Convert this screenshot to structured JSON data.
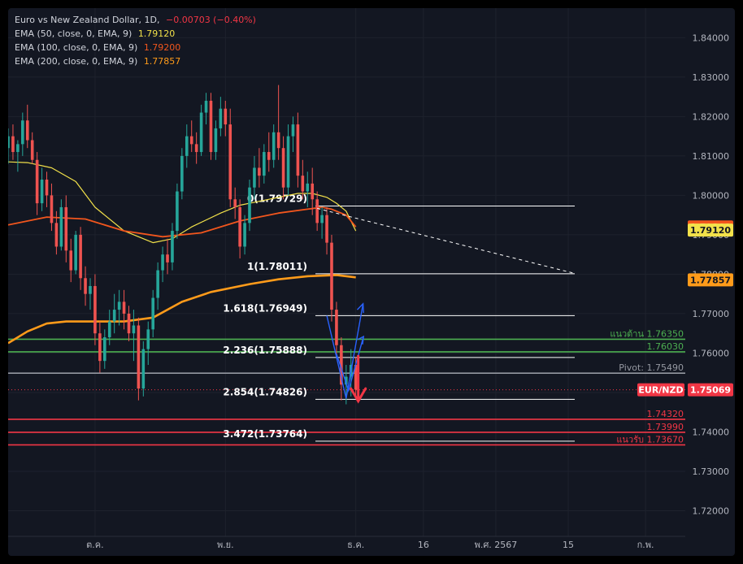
{
  "legend": {
    "symbol": "Euro vs New Zealand Dollar, 1D,",
    "change": "−0.00703 (−0.40%)",
    "ema50": {
      "label": "EMA (50, close, 0, EMA, 9)",
      "value": "1.79120",
      "color": "#f2e14a"
    },
    "ema100": {
      "label": "EMA (100, close, 0, EMA, 9)",
      "value": "1.79200",
      "color": "#f2561d"
    },
    "ema200": {
      "label": "EMA (200, close, 0, EMA, 9)",
      "value": "1.77857",
      "color": "#ff9b1a"
    }
  },
  "colors": {
    "up": "#26a69a",
    "down": "#ef5350",
    "background": "#131722",
    "text": "#b2b5be",
    "grid": "#1e222d"
  },
  "chart_data": {
    "type": "candlestick",
    "y_axis_ticks": [
      "1.84000",
      "1.83000",
      "1.82000",
      "1.81000",
      "1.80000",
      "1.79000",
      "1.78000",
      "1.77000",
      "1.76000",
      "1.75000",
      "1.74000",
      "1.73000",
      "1.72000"
    ],
    "ylim": [
      1.7135,
      1.8475
    ],
    "x_axis_labels": [
      {
        "label": "ต.ค.",
        "idx": 18
      },
      {
        "label": "พ.ย.",
        "idx": 45
      },
      {
        "label": "ธ.ค.",
        "idx": 72
      },
      {
        "label": "16",
        "idx": 86
      },
      {
        "label": "พ.ศ. 2567",
        "idx": 101
      },
      {
        "label": "15",
        "idx": 116
      },
      {
        "label": "ก.พ.",
        "idx": 132
      }
    ],
    "candles": [
      [
        1.812,
        1.817,
        1.808,
        1.815
      ],
      [
        1.815,
        1.818,
        1.809,
        1.811
      ],
      [
        1.811,
        1.814,
        1.806,
        1.813
      ],
      [
        1.813,
        1.821,
        1.81,
        1.819
      ],
      [
        1.819,
        1.823,
        1.812,
        1.814
      ],
      [
        1.814,
        1.816,
        1.808,
        1.809
      ],
      [
        1.809,
        1.811,
        1.795,
        1.798
      ],
      [
        1.798,
        1.807,
        1.796,
        1.804
      ],
      [
        1.804,
        1.806,
        1.797,
        1.8
      ],
      [
        1.8,
        1.803,
        1.791,
        1.793
      ],
      [
        1.793,
        1.796,
        1.785,
        1.787
      ],
      [
        1.787,
        1.799,
        1.786,
        1.797
      ],
      [
        1.797,
        1.8,
        1.783,
        1.786
      ],
      [
        1.786,
        1.789,
        1.778,
        1.781
      ],
      [
        1.781,
        1.791,
        1.78,
        1.79
      ],
      [
        1.79,
        1.792,
        1.776,
        1.779
      ],
      [
        1.779,
        1.782,
        1.772,
        1.775
      ],
      [
        1.775,
        1.779,
        1.771,
        1.777
      ],
      [
        1.777,
        1.78,
        1.762,
        1.765
      ],
      [
        1.765,
        1.768,
        1.755,
        1.758
      ],
      [
        1.758,
        1.766,
        1.756,
        1.764
      ],
      [
        1.764,
        1.771,
        1.762,
        1.768
      ],
      [
        1.768,
        1.775,
        1.765,
        1.771
      ],
      [
        1.771,
        1.776,
        1.767,
        1.773
      ],
      [
        1.773,
        1.776,
        1.766,
        1.77
      ],
      [
        1.77,
        1.772,
        1.763,
        1.765
      ],
      [
        1.765,
        1.771,
        1.758,
        1.767
      ],
      [
        1.767,
        1.769,
        1.748,
        1.751
      ],
      [
        1.751,
        1.763,
        1.749,
        1.761
      ],
      [
        1.761,
        1.768,
        1.757,
        1.766
      ],
      [
        1.766,
        1.776,
        1.764,
        1.774
      ],
      [
        1.774,
        1.783,
        1.771,
        1.781
      ],
      [
        1.781,
        1.787,
        1.778,
        1.785
      ],
      [
        1.785,
        1.789,
        1.78,
        1.783
      ],
      [
        1.783,
        1.793,
        1.781,
        1.791
      ],
      [
        1.791,
        1.803,
        1.789,
        1.801
      ],
      [
        1.801,
        1.812,
        1.799,
        1.81
      ],
      [
        1.81,
        1.818,
        1.807,
        1.815
      ],
      [
        1.815,
        1.819,
        1.811,
        1.813
      ],
      [
        1.813,
        1.816,
        1.808,
        1.811
      ],
      [
        1.811,
        1.823,
        1.81,
        1.821
      ],
      [
        1.821,
        1.826,
        1.818,
        1.824
      ],
      [
        1.824,
        1.826,
        1.809,
        1.811
      ],
      [
        1.811,
        1.819,
        1.809,
        1.817
      ],
      [
        1.817,
        1.825,
        1.815,
        1.822
      ],
      [
        1.822,
        1.824,
        1.815,
        1.818
      ],
      [
        1.818,
        1.822,
        1.797,
        1.799
      ],
      [
        1.799,
        1.802,
        1.794,
        1.797
      ],
      [
        1.797,
        1.799,
        1.784,
        1.787
      ],
      [
        1.787,
        1.795,
        1.785,
        1.793
      ],
      [
        1.793,
        1.804,
        1.791,
        1.802
      ],
      [
        1.802,
        1.81,
        1.799,
        1.807
      ],
      [
        1.807,
        1.812,
        1.802,
        1.805
      ],
      [
        1.805,
        1.813,
        1.803,
        1.811
      ],
      [
        1.811,
        1.816,
        1.806,
        1.809
      ],
      [
        1.809,
        1.818,
        1.807,
        1.816
      ],
      [
        1.816,
        1.828,
        1.809,
        1.812
      ],
      [
        1.812,
        1.815,
        1.799,
        1.802
      ],
      [
        1.802,
        1.818,
        1.8,
        1.815
      ],
      [
        1.815,
        1.82,
        1.811,
        1.818
      ],
      [
        1.818,
        1.821,
        1.802,
        1.805
      ],
      [
        1.805,
        1.809,
        1.799,
        1.801
      ],
      [
        1.801,
        1.806,
        1.797,
        1.803
      ],
      [
        1.803,
        1.807,
        1.795,
        1.799
      ],
      [
        1.799,
        1.801,
        1.791,
        1.793
      ],
      [
        1.793,
        1.797,
        1.789,
        1.795
      ],
      [
        1.795,
        1.797,
        1.785,
        1.788
      ],
      [
        1.788,
        1.79,
        1.768,
        1.771
      ],
      [
        1.771,
        1.773,
        1.759,
        1.762
      ],
      [
        1.762,
        1.764,
        1.748,
        1.752
      ],
      [
        1.752,
        1.757,
        1.747,
        1.754
      ],
      [
        1.754,
        1.761,
        1.749,
        1.757
      ],
      [
        1.757,
        1.759,
        1.749,
        1.7507
      ]
    ],
    "ema_series": [
      {
        "name": "EMA 50",
        "color": "#f2e14a",
        "points": [
          [
            0,
            1.8085
          ],
          [
            4,
            1.8083
          ],
          [
            9,
            1.807
          ],
          [
            14,
            1.8035
          ],
          [
            18,
            1.797
          ],
          [
            24,
            1.791
          ],
          [
            30,
            1.788
          ],
          [
            34,
            1.789
          ],
          [
            38,
            1.792
          ],
          [
            44,
            1.7955
          ],
          [
            48,
            1.7975
          ],
          [
            52,
            1.7985
          ],
          [
            56,
            1.7995
          ],
          [
            60,
            1.8005
          ],
          [
            63,
            1.8005
          ],
          [
            66,
            1.7995
          ],
          [
            68,
            1.798
          ],
          [
            70,
            1.796
          ],
          [
            72,
            1.791
          ]
        ]
      },
      {
        "name": "EMA 100",
        "color": "#f2561d",
        "points": [
          [
            0,
            1.7925
          ],
          [
            8,
            1.7945
          ],
          [
            16,
            1.794
          ],
          [
            24,
            1.791
          ],
          [
            32,
            1.7895
          ],
          [
            40,
            1.7905
          ],
          [
            48,
            1.7935
          ],
          [
            56,
            1.7955
          ],
          [
            62,
            1.7965
          ],
          [
            65,
            1.797
          ],
          [
            67,
            1.7965
          ],
          [
            70,
            1.795
          ],
          [
            72,
            1.792
          ]
        ]
      },
      {
        "name": "EMA 200",
        "color": "#ff9b1a",
        "points": [
          [
            0,
            1.7625
          ],
          [
            4,
            1.7655
          ],
          [
            8,
            1.7675
          ],
          [
            12,
            1.768
          ],
          [
            18,
            1.768
          ],
          [
            24,
            1.768
          ],
          [
            30,
            1.769
          ],
          [
            36,
            1.773
          ],
          [
            42,
            1.7755
          ],
          [
            50,
            1.7775
          ],
          [
            56,
            1.7787
          ],
          [
            62,
            1.7795
          ],
          [
            68,
            1.7798
          ],
          [
            72,
            1.7792
          ]
        ]
      }
    ],
    "fibonacci": [
      {
        "label": "0(1.79729)",
        "price": 1.79729
      },
      {
        "label": "1(1.78011)",
        "price": 1.78011
      },
      {
        "label": "1.618(1.76949)",
        "price": 1.76949
      },
      {
        "label": "2.236(1.75888)",
        "price": 1.75888
      },
      {
        "label": "2.854(1.74826)",
        "price": 1.74826
      },
      {
        "label": "3.472(1.73764)",
        "price": 1.73764
      }
    ],
    "levels": [
      {
        "label": "แนวต้าน 1.76350",
        "price": 1.7635,
        "color": "#4caf50"
      },
      {
        "label": "1.76030",
        "price": 1.7603,
        "color": "#4caf50"
      },
      {
        "label": "Pivot: 1.75490",
        "price": 1.7549,
        "color": "#9598a1"
      },
      {
        "label": "1.74320",
        "price": 1.7432,
        "color": "#f23645"
      },
      {
        "label": "1.73990",
        "price": 1.7399,
        "color": "#f23645"
      },
      {
        "label": "แนวรับ 1.73670",
        "price": 1.7367,
        "color": "#f23645"
      }
    ],
    "price_badges": [
      {
        "text": "1.79200",
        "price": 1.792,
        "bg": "#f2561d",
        "fg": "#ffffff"
      },
      {
        "text": "1.79120",
        "price": 1.7912,
        "bg": "#f2e14a",
        "fg": "#131722"
      },
      {
        "text": "1.77857",
        "price": 1.77857,
        "bg": "#ff9b1a",
        "fg": "#131722"
      },
      {
        "text": "1.75069",
        "price": 1.75069,
        "bg": "#f23645",
        "fg": "#ffffff"
      }
    ],
    "symbol_badge": "EUR/NZD",
    "current_price": 1.75069
  }
}
